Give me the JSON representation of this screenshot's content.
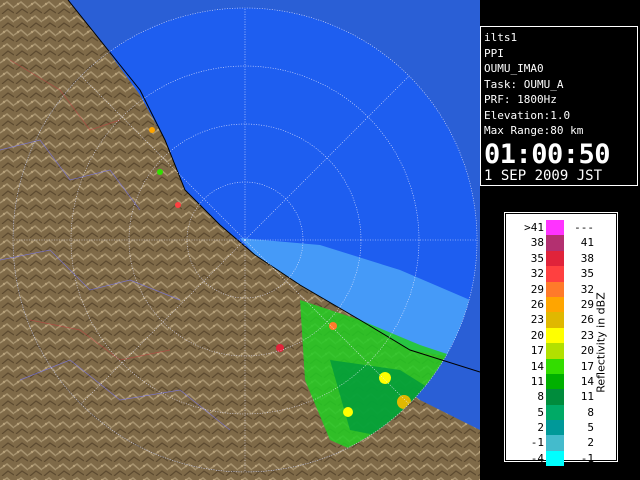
{
  "info": {
    "line1": "ilts1",
    "line2": "PPI",
    "line3": "OUMU_IMA0",
    "task": "Task: OUMU_A",
    "prf": "PRF: 1800Hz",
    "elevation": "Elevation:1.0",
    "max_range": "Max Range:80 km",
    "time": "01:00:50",
    "date": "1 SEP 2009 JST"
  },
  "legend": {
    "unit": "Reflectivity in dBZ",
    "rows": [
      {
        "left": ">41",
        "right": "---",
        "color": "#ff33ff"
      },
      {
        "left": "38",
        "right": "41",
        "color": "#b33070"
      },
      {
        "left": "35",
        "right": "38",
        "color": "#e0233a"
      },
      {
        "left": "32",
        "right": "35",
        "color": "#ff4040"
      },
      {
        "left": "29",
        "right": "32",
        "color": "#ff7a2a"
      },
      {
        "left": "26",
        "right": "29",
        "color": "#ffa500"
      },
      {
        "left": "23",
        "right": "26",
        "color": "#e0b800"
      },
      {
        "left": "20",
        "right": "23",
        "color": "#ffff00"
      },
      {
        "left": "17",
        "right": "20",
        "color": "#b2e000"
      },
      {
        "left": "14",
        "right": "17",
        "color": "#33dd00"
      },
      {
        "left": "11",
        "right": "14",
        "color": "#00b000"
      },
      {
        "left": "8",
        "right": "11",
        "color": "#008c3c"
      },
      {
        "left": "5",
        "right": "8",
        "color": "#00aa66"
      },
      {
        "left": "2",
        "right": "5",
        "color": "#009999"
      },
      {
        "left": "-1",
        "right": "2",
        "color": "#44bbcc"
      },
      {
        "left": "-4",
        "right": "-1",
        "color": "#00ffff"
      }
    ]
  },
  "colors": {
    "sea": "#1e5ef0",
    "outer_sea": "#2a5fd6",
    "land": "#8a7450",
    "ring": "#e8e8ff"
  }
}
